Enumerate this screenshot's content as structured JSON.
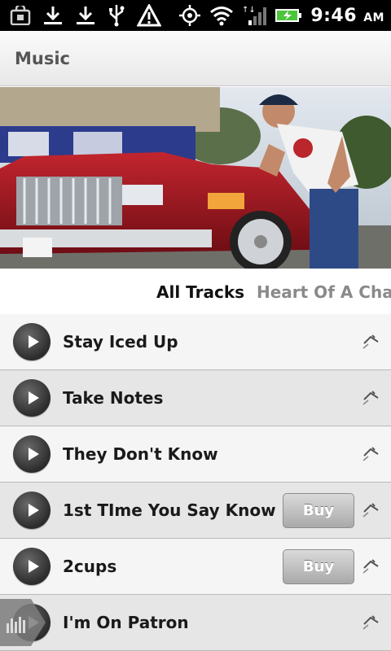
{
  "status_bar": {
    "time": "9:46",
    "ampm": "AM",
    "left_icons": [
      "shopping-bag-icon",
      "download-icon",
      "download-icon",
      "usb-icon",
      "warning-icon"
    ],
    "right_icons": [
      "gps-icon",
      "wifi-icon",
      "signal-icon",
      "battery-charging-icon"
    ]
  },
  "app_title": "Music",
  "tabs": [
    {
      "label": "All Tracks",
      "active": true
    },
    {
      "label": "Heart Of A Champ",
      "active": false
    }
  ],
  "tracks": [
    {
      "title": "Stay Iced Up",
      "buy": ""
    },
    {
      "title": "Take Notes",
      "buy": ""
    },
    {
      "title": "They Don't Know",
      "buy": ""
    },
    {
      "title": "1st TIme You Say Know",
      "buy": "Buy"
    },
    {
      "title": "2cups",
      "buy": "Buy"
    },
    {
      "title": "I'm On Patron",
      "buy": ""
    }
  ],
  "colors": {
    "status_bar_bg": "#000000",
    "title_text": "#555555",
    "row_light": "#f5f5f5",
    "row_dark": "#e6e6e6",
    "buy_button": "#b5b5b5"
  }
}
